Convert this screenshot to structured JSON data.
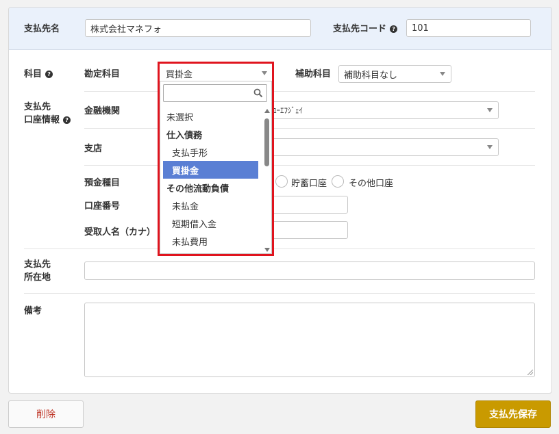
{
  "payee": {
    "name_label": "支払先名",
    "name_value": "株式会社マネフォ",
    "code_label": "支払先コード",
    "code_value": "101"
  },
  "account_item": {
    "label": "科目",
    "kanjo_label": "勘定科目",
    "kanjo_selected": "買掛金",
    "hojo_label": "補助科目",
    "hojo_selected": "補助科目なし"
  },
  "bank": {
    "section_label_line1": "支払先",
    "section_label_line2": "口座情報",
    "institution_label": "金融機関",
    "institution_value": "ﾕｰｴﾌｼﾞｪｲ",
    "branch_label": "支店",
    "branch_value": "",
    "deposit_type_label": "預金種目",
    "deposit_options": [
      "貯蓄口座",
      "その他口座"
    ],
    "account_number_label": "口座番号",
    "account_number_value": "",
    "recipient_label": "受取人名（カナ）",
    "recipient_value": ""
  },
  "address": {
    "label_line1": "支払先",
    "label_line2": "所在地",
    "value": ""
  },
  "notes": {
    "label": "備考",
    "value": ""
  },
  "dropdown": {
    "search_value": "",
    "options": [
      {
        "label": "未選択",
        "kind": "plain"
      },
      {
        "label": "仕入債務",
        "kind": "group"
      },
      {
        "label": "支払手形",
        "kind": "item"
      },
      {
        "label": "買掛金",
        "kind": "selected"
      },
      {
        "label": "その他流動負債",
        "kind": "group"
      },
      {
        "label": "未払金",
        "kind": "item"
      },
      {
        "label": "短期借入金",
        "kind": "item"
      },
      {
        "label": "未払費用",
        "kind": "item"
      }
    ]
  },
  "buttons": {
    "delete_label": "削除",
    "save_label": "支払先保存"
  },
  "colors": {
    "header_band": "#eaf1fb",
    "highlight_outline": "#e0141e",
    "selected_option": "#5a7fd4",
    "save_button": "#c99a00",
    "delete_text": "#c0392b"
  }
}
